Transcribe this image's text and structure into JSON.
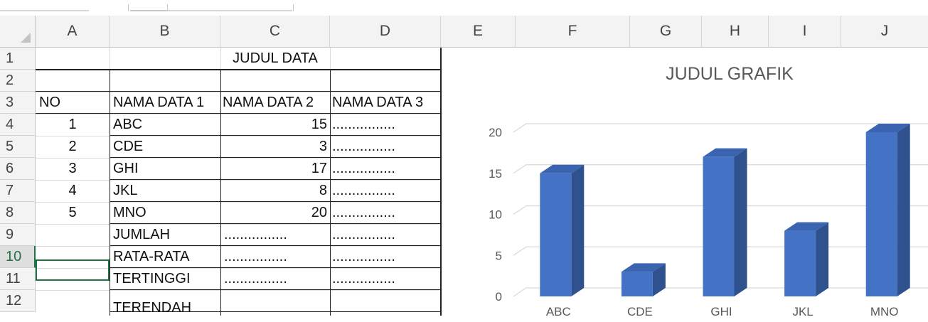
{
  "columns": [
    "A",
    "B",
    "C",
    "D",
    "E",
    "F",
    "G",
    "H",
    "I",
    "J"
  ],
  "rows": [
    "1",
    "2",
    "3",
    "4",
    "5",
    "6",
    "7",
    "8",
    "9",
    "10",
    "11",
    "12"
  ],
  "selected_row": "10",
  "sheet": {
    "title": "JUDUL DATA",
    "headers": [
      "NO",
      "NAMA DATA 1",
      "NAMA DATA 2",
      "NAMA DATA 3"
    ],
    "data_rows": [
      {
        "no": "1",
        "name": "ABC",
        "value": "15",
        "d3": "................"
      },
      {
        "no": "2",
        "name": "CDE",
        "value": "3",
        "d3": "................"
      },
      {
        "no": "3",
        "name": "GHI",
        "value": "17",
        "d3": "................"
      },
      {
        "no": "4",
        "name": "JKL",
        "value": "8",
        "d3": "................"
      },
      {
        "no": "5",
        "name": "MNO",
        "value": "20",
        "d3": "................"
      }
    ],
    "summary_rows": [
      {
        "label": "JUMLAH",
        "c": "................",
        "d": "................"
      },
      {
        "label": "RATA-RATA",
        "c": "................",
        "d": "................"
      },
      {
        "label": "TERTINGGI",
        "c": "................",
        "d": "................"
      },
      {
        "label": "TERENDAH",
        "c": "",
        "d": ""
      }
    ]
  },
  "colors": {
    "bar_front": "#4472c4",
    "bar_side": "#2f528f",
    "bar_top": "#3a64b0",
    "accent": "#217346"
  },
  "chart_data": {
    "type": "bar",
    "title": "JUDUL GRAFIK",
    "categories": [
      "ABC",
      "CDE",
      "GHI",
      "JKL",
      "MNO"
    ],
    "values": [
      15,
      3,
      17,
      8,
      20
    ],
    "ylim": [
      0,
      20
    ],
    "yticks": [
      "0",
      "5",
      "10",
      "15",
      "20"
    ],
    "grid": true,
    "style": "3d-column"
  }
}
